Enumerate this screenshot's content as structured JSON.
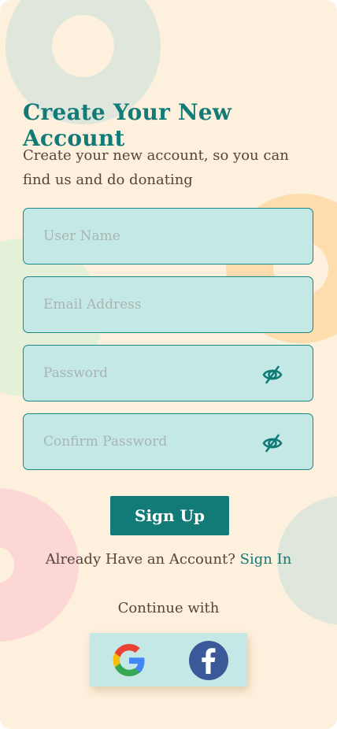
{
  "header": {
    "title": "Create Your New Account",
    "subtitle": "Create your new account, so you can find us and do donating"
  },
  "form": {
    "username_placeholder": "User Name",
    "email_placeholder": "Email Address",
    "password_placeholder": "Password",
    "confirm_password_placeholder": "Confirm Password",
    "password_icon": "eye-slash-icon",
    "confirm_password_icon": "eye-slash-icon"
  },
  "actions": {
    "signup_label": "Sign Up",
    "have_account_text": "Already Have an Account?",
    "signin_label": "Sign In",
    "continue_with": "Continue with"
  },
  "social": {
    "google_icon": "google-icon",
    "facebook_icon": "facebook-icon"
  },
  "colors": {
    "background": "#fdf0dd",
    "primary": "#127b78",
    "field_fill": "#c4e8e5",
    "text": "#55443a",
    "facebook": "#3b5998"
  }
}
